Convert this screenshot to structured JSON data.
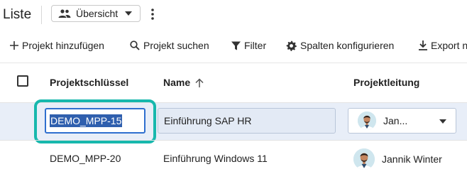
{
  "header": {
    "title": "Liste",
    "view_label": "Übersicht"
  },
  "toolbar": {
    "add_label": "Projekt hinzufügen",
    "search_label": "Projekt suchen",
    "filter_label": "Filter",
    "columns_label": "Spalten konfigurieren",
    "export_label": "Export n"
  },
  "table": {
    "columns": [
      "Projektschlüssel",
      "Name",
      "Projektleitung"
    ],
    "sort_column": "Name",
    "sort_direction": "ascending",
    "rows": [
      {
        "key": "DEMO_MPP-15",
        "name": "Einführung SAP HR",
        "lead": "Jan..."
      },
      {
        "key": "DEMO_MPP-20",
        "name": "Einführung Windows 11",
        "lead": "Jannik Winter"
      }
    ]
  },
  "colors": {
    "focus_ring": "#17b8ad",
    "selected_row": "#e8eef8",
    "input_border": "#2f6fcf"
  }
}
